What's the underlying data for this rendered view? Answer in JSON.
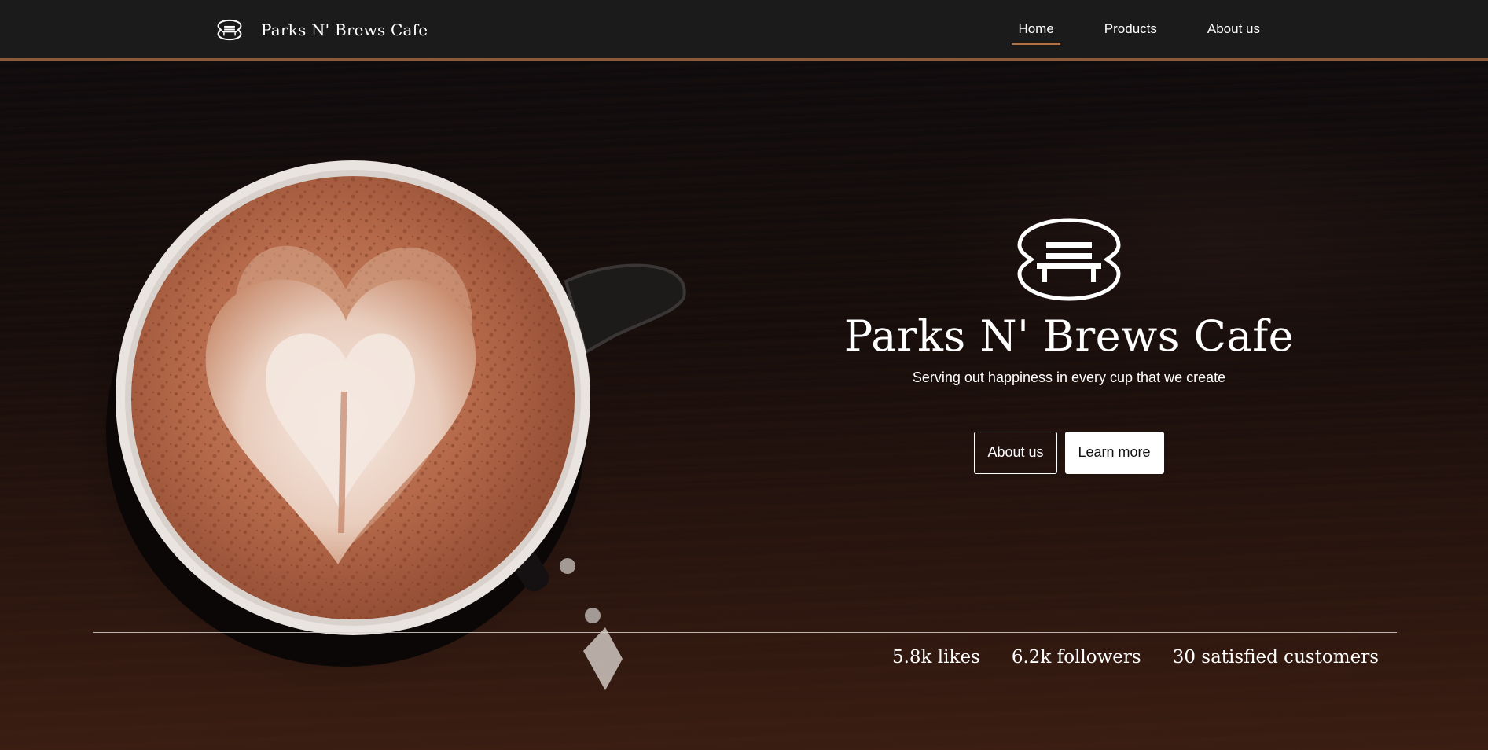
{
  "nav": {
    "brand": "Parks N' Brews Cafe",
    "links": [
      {
        "label": "Home",
        "active": true
      },
      {
        "label": "Products",
        "active": false
      },
      {
        "label": "About us",
        "active": false
      }
    ]
  },
  "hero": {
    "title": "Parks N' Brews Cafe",
    "subtitle": "Serving out happiness in every cup that we create",
    "buttons": {
      "about": "About us",
      "learn": "Learn more"
    }
  },
  "stats": [
    "5.8k likes",
    "6.2k followers",
    "30 satisfied customers"
  ],
  "colors": {
    "nav_bg": "#1b1b1b",
    "accent": "#8a5a3a",
    "hero_bg": "#160d0b"
  },
  "icons": {
    "logo": "park-bench-logo-icon"
  }
}
